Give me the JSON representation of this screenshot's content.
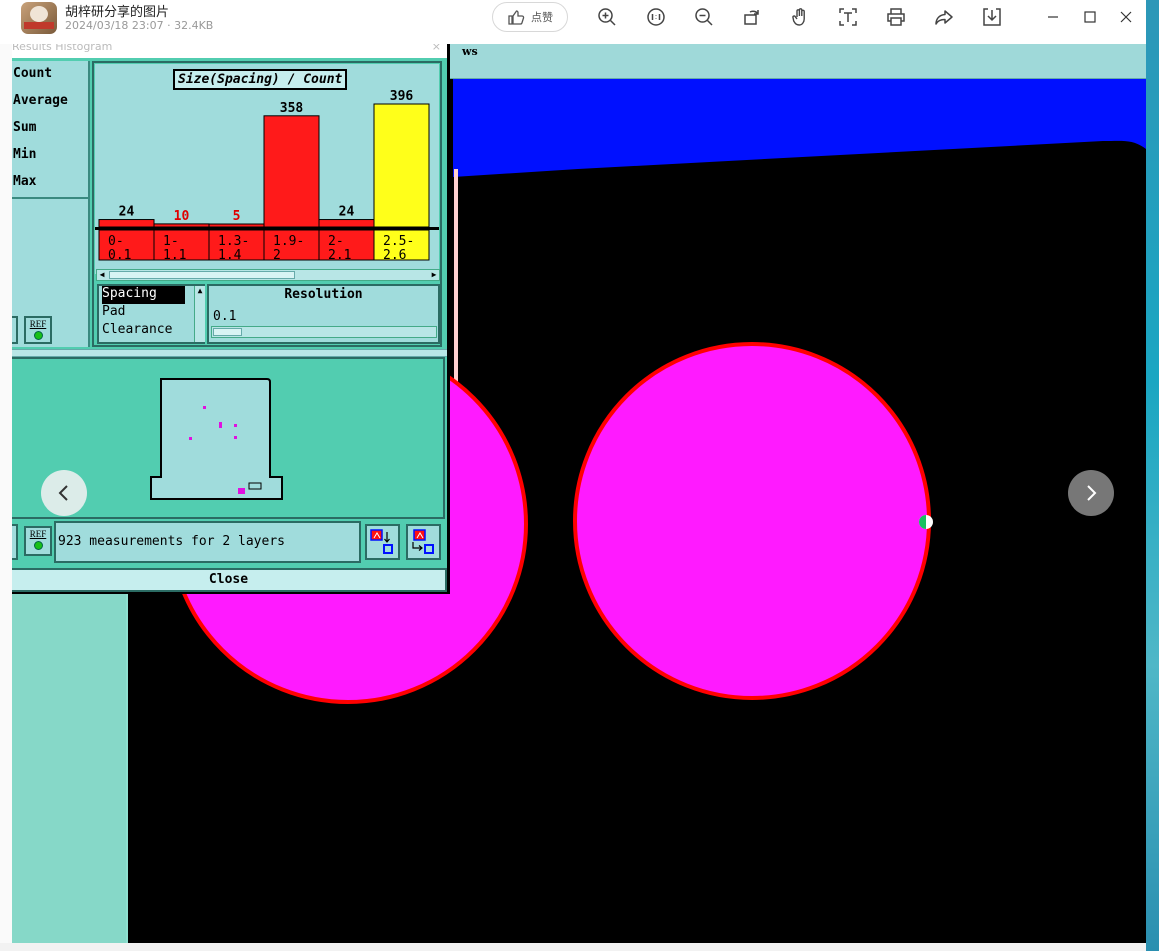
{
  "viewer": {
    "file_title": "胡梓研分享的图片",
    "file_meta": "2024/03/18 23:07 · 32.4KB",
    "like_label": "点赞",
    "toolbar_icons": [
      "zoom-in-icon",
      "fit-one-to-one-icon",
      "zoom-out-icon",
      "rotate-icon",
      "hand-pan-icon",
      "text-ocr-icon",
      "print-icon",
      "share-icon",
      "download-icon"
    ],
    "window_controls": [
      "minimize-icon",
      "maximize-icon",
      "close-icon"
    ],
    "nav_prev_icon": "chevron-left-icon",
    "nav_next_icon": "chevron-right-icon"
  },
  "cad": {
    "menu_fragment": "ws",
    "colors": {
      "canvas": "#000000",
      "pad_fill": "#ff1aff",
      "pad_outline": "#ff0000",
      "copper": "#0010ff",
      "panel": "#52cdb0",
      "panel_light": "#a0dcdc"
    }
  },
  "dialog": {
    "title": "Results Histogram",
    "stats": [
      "Count",
      "Average",
      "Sum",
      "Min",
      "Max"
    ],
    "types": [
      "Spacing",
      "Pad",
      "Clearance"
    ],
    "selected_type": "Spacing",
    "resolution_label": "Resolution",
    "resolution_value": "0.1",
    "status_text": "923 measurements for 2 layers",
    "ref_label": "REF",
    "close_label": "Close"
  },
  "chart_data": {
    "type": "bar",
    "title": "Size(Spacing) / Count",
    "categories": [
      "0-\n 0.1",
      "1-\n 1.1",
      "1.3-\n 1.4",
      "1.9-\n 2",
      "2-\n 2.1",
      "2.5-\n 2.6"
    ],
    "values": [
      24,
      10,
      5,
      358,
      24,
      396
    ],
    "value_label_colors": [
      "#000000",
      "#e00000",
      "#e00000",
      "#000000",
      "#000000",
      "#000000"
    ],
    "bar_colors": [
      "#ff1a1a",
      "#ff1a1a",
      "#ff1a1a",
      "#ff1a1a",
      "#ff1a1a",
      "#ffff1a"
    ],
    "ylim": [
      0,
      396
    ],
    "grid": false
  }
}
